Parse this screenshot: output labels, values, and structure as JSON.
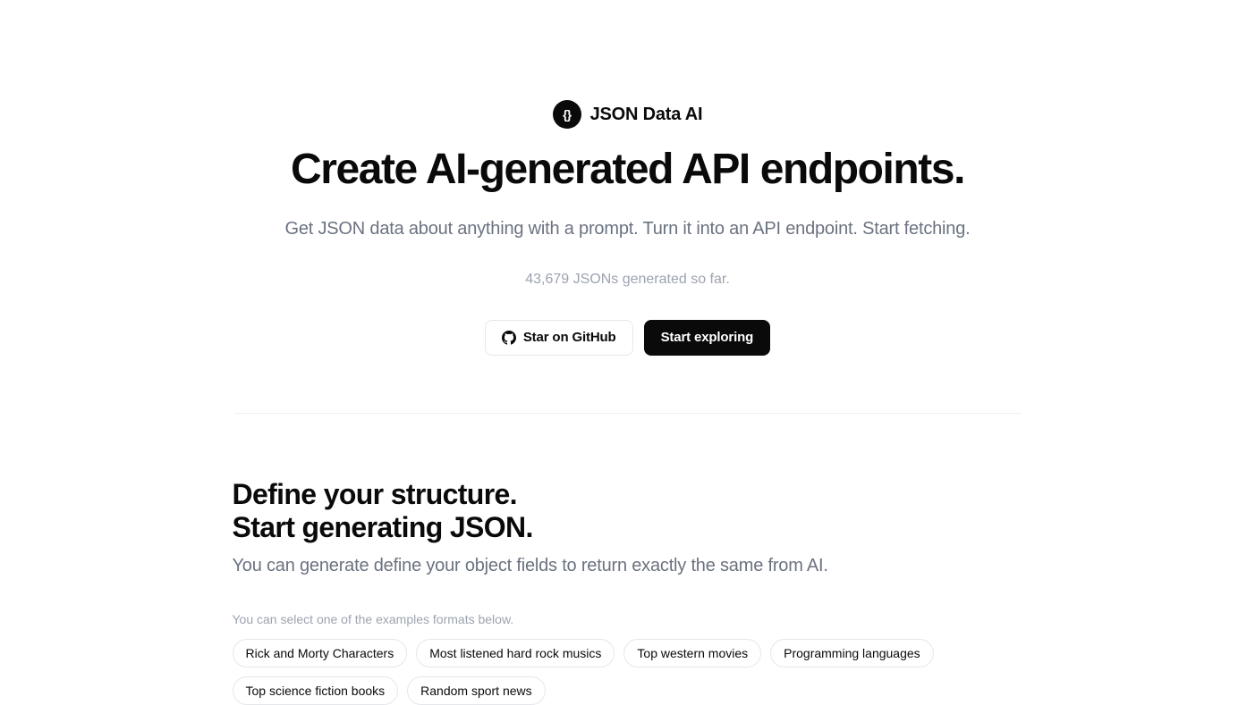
{
  "brand": {
    "name": "JSON Data AI"
  },
  "hero": {
    "headline": "Create AI-generated API endpoints.",
    "subhead": "Get JSON data about anything with a prompt. Turn it into an API endpoint. Start fetching.",
    "stat": "43,679 JSONs generated so far."
  },
  "cta": {
    "github_label": "Star on GitHub",
    "primary_label": "Start exploring"
  },
  "section": {
    "title_line1": "Define your structure.",
    "title_line2": "Start generating JSON.",
    "sub": "You can generate define your object fields to return exactly the same from AI.",
    "hint": "You can select one of the examples formats below."
  },
  "examples": [
    "Rick and Morty Characters",
    "Most listened hard rock musics",
    "Top western movies",
    "Programming languages",
    "Top science fiction books",
    "Random sport news"
  ]
}
